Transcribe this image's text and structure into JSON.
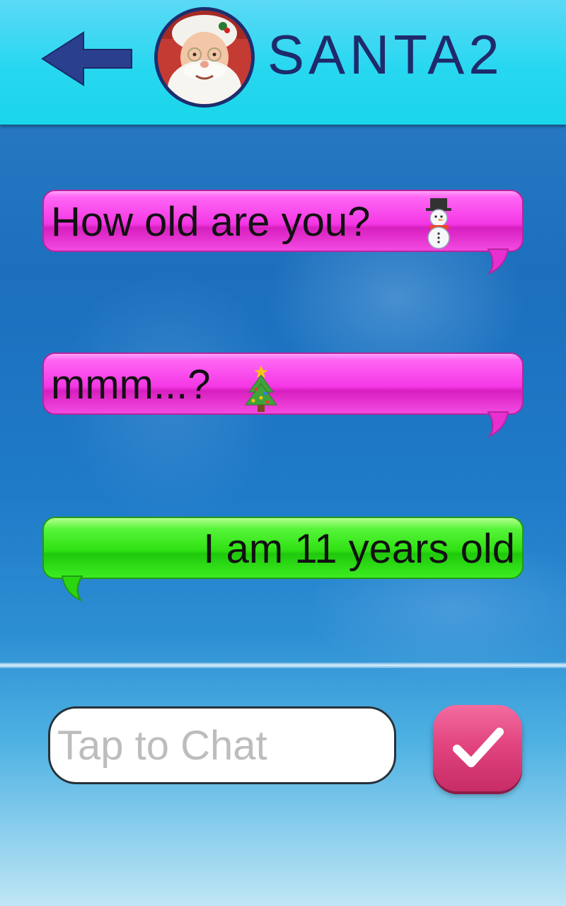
{
  "header": {
    "title": "SANTA2",
    "back_icon": "left-arrow-icon",
    "avatar": "santa-avatar-photo"
  },
  "messages": [
    {
      "sender": "user",
      "text": "How old are you?",
      "emoji": "snowman-icon",
      "color": "#f437e5"
    },
    {
      "sender": "user",
      "text": "mmm...?",
      "emoji": "christmas-tree-icon",
      "color": "#f437e5"
    },
    {
      "sender": "santa",
      "text": "I am 11 years old",
      "color": "#2ee012"
    }
  ],
  "composer": {
    "placeholder": "Tap to Chat",
    "value": "",
    "send_icon": "checkmark-icon",
    "send_color": "#e2457f"
  },
  "colors": {
    "header": "#1ad6ea",
    "title": "#1e2a6b",
    "arrow": "#2b3f8f"
  }
}
